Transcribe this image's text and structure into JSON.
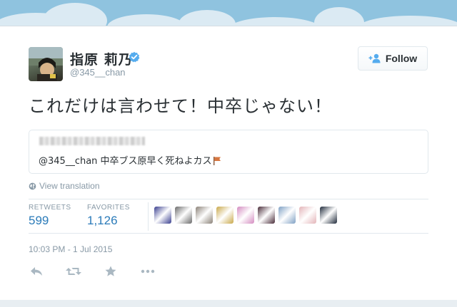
{
  "tweet": {
    "author_name": "指原 莉乃",
    "handle": "@345__chan",
    "follow_label": "Follow",
    "text": "これだけは言わせて！中卒じゃない！",
    "quote": {
      "text": "@345__chan 中卒ブス原早く死ねよカス"
    },
    "view_translation": "View translation",
    "stats": {
      "retweets_label": "RETWEETS",
      "retweets_value": "599",
      "favorites_label": "FAVORITES",
      "favorites_value": "1,126"
    },
    "timestamp": "10:03 PM - 1 Jul 2015"
  },
  "favorited_by": [
    {
      "name": "fav-avatar-1",
      "color": "#3a3f8f"
    },
    {
      "name": "fav-avatar-2",
      "color": "#6b6b6b"
    },
    {
      "name": "fav-avatar-3",
      "color": "#8b8278"
    },
    {
      "name": "fav-avatar-4",
      "color": "#c9a84a"
    },
    {
      "name": "fav-avatar-5",
      "color": "#d48bc0"
    },
    {
      "name": "fav-avatar-6",
      "color": "#4a2d3a"
    },
    {
      "name": "fav-avatar-7",
      "color": "#7fa0c4"
    },
    {
      "name": "fav-avatar-8",
      "color": "#e3b4b8"
    },
    {
      "name": "fav-avatar-9",
      "color": "#1f2a3a"
    }
  ],
  "colors": {
    "link": "#2b7bb9",
    "muted": "#8899a6",
    "text": "#292f33",
    "verified": "#55acee"
  },
  "icons": [
    "verified-badge-icon",
    "follow-user-icon",
    "globe-icon",
    "flag-icon",
    "reply-icon",
    "retweet-icon",
    "favorite-icon",
    "more-icon"
  ]
}
